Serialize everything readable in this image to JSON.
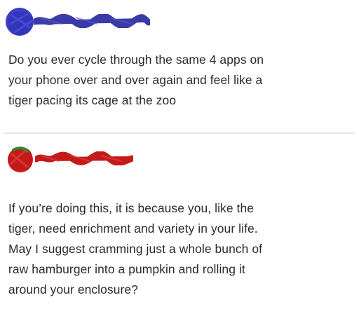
{
  "posts": [
    {
      "author": "redacted",
      "avatar_color": "#3b3fc4",
      "scribble_color": "#3a3aa8",
      "lines": [
        "Do you ever cycle through the same 4 apps on",
        "your phone over and over again and feel like a",
        "tiger pacing its cage at the zoo"
      ]
    },
    {
      "author": "redacted",
      "avatar_color": "#d42222",
      "scribble_color": "#c41a1a",
      "lines": [
        "If you’re doing this, it is because you, like the",
        "tiger, need enrichment and variety in your life.",
        "May I suggest cramming just a whole bunch of",
        "raw hamburger into a pumpkin and rolling it",
        "around your enclosure?"
      ]
    }
  ]
}
